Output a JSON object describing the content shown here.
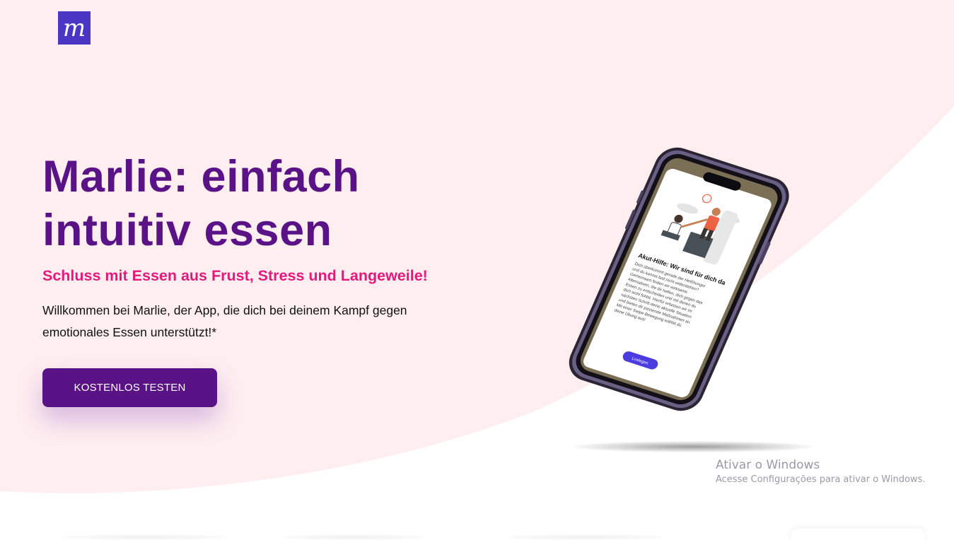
{
  "brand": {
    "logo_letter": "m",
    "logo_color": "#4a35c5"
  },
  "hero": {
    "title_line1": "Marlie: einfach",
    "title_line2": "intuitiv essen",
    "subtitle": "Schluss mit Essen aus Frust, Stress und Langeweile!",
    "text_line1": "Willkommen bei Marlie, der App, die dich bei deinem Kampf gegen",
    "text_line2": "emotionales Essen unterstützt!*",
    "cta_label": "KOSTENLOS TESTEN"
  },
  "phone": {
    "screen_title": "Akut-Hilfe: Wir sind für dich da",
    "screen_body": [
      "Dich überkommt gerade der Heißhunger",
      "und du kannst fast nicht widerstehen?",
      "Gemeinsam finden wir wirksame",
      "Alternativen, die dir helfen, dich gegen das",
      "Essen zu entscheiden und mit denen du",
      "dich wohl fühlst. Hierfür erfassen wir im",
      "nächsten Schritt deine aktuelle Situation",
      "und bieten dir passende Maßnahmen an.",
      "Mit einer Swipe-Bewegung wählst du",
      "deine Übung aus!"
    ],
    "screen_button": "Loslegen",
    "icon": "phone-mockup"
  },
  "watermark": {
    "title": "Ativar o Windows",
    "subtitle": "Acesse Configurações para ativar o Windows."
  },
  "colors": {
    "background_pink": "#feeef0",
    "title_purple": "#5a1386",
    "subtitle_pink": "#e5197c",
    "button_purple": "#5a1386",
    "phone_accent": "#4b3ce0"
  }
}
